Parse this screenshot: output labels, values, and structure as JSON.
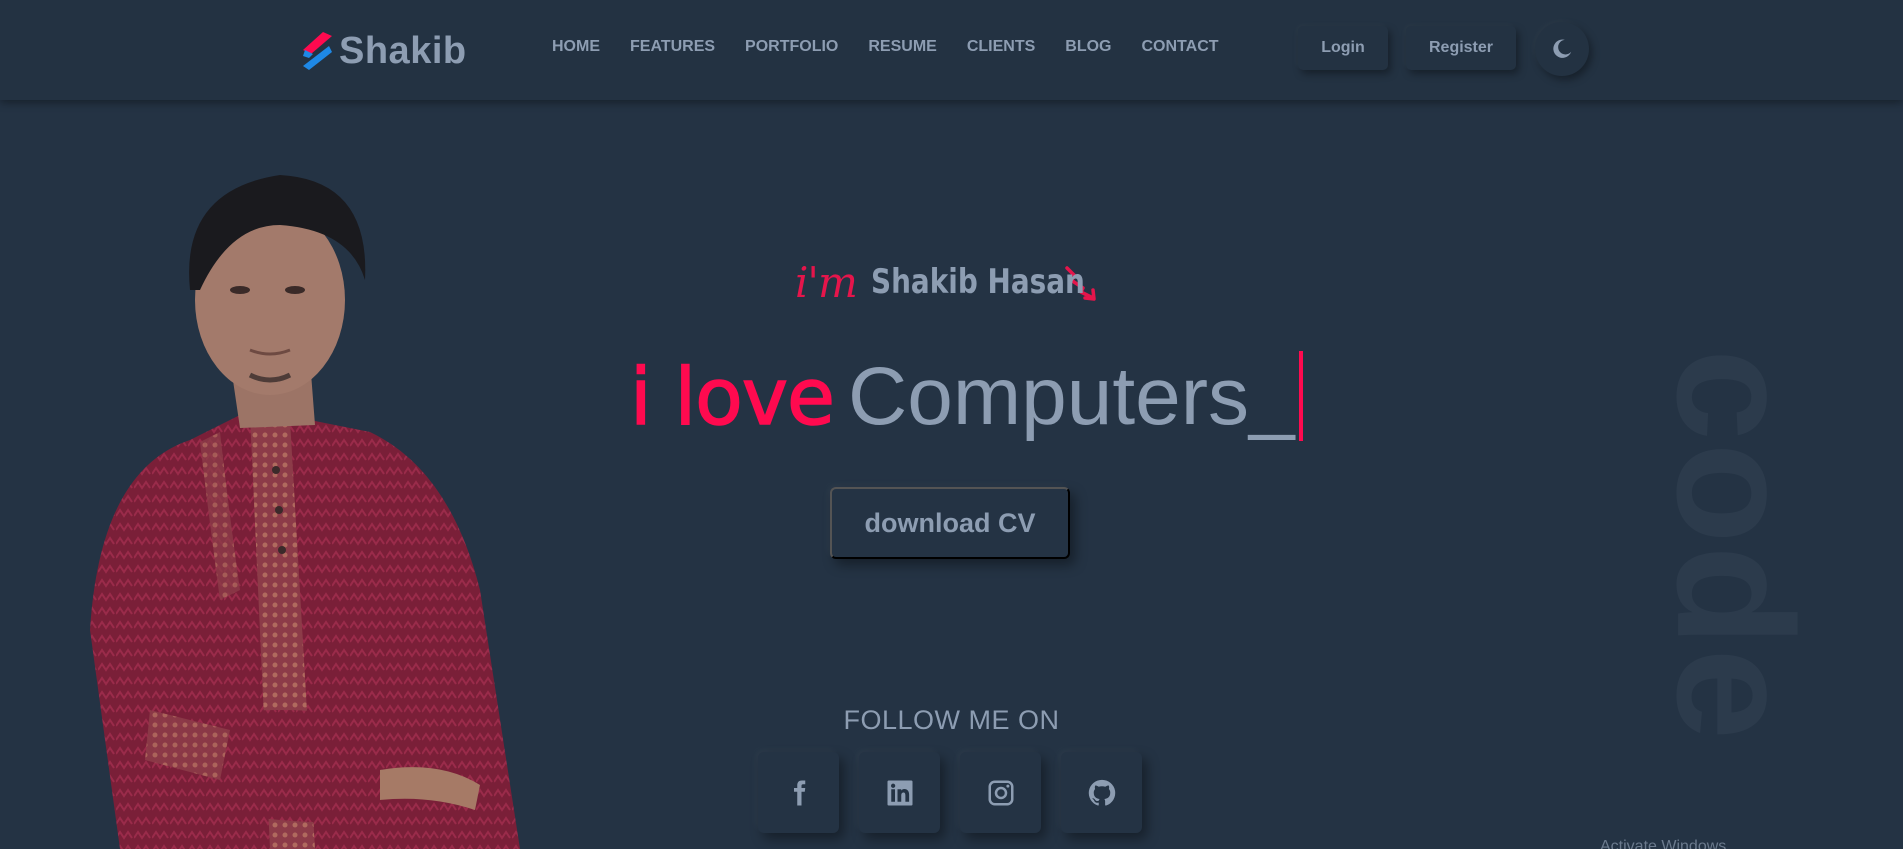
{
  "brand": {
    "name": "Shakib",
    "accent_colors": [
      "#ff0a4f",
      "#1e88e5"
    ]
  },
  "nav": {
    "items": [
      {
        "label": "HOME"
      },
      {
        "label": "FEATURES"
      },
      {
        "label": "PORTFOLIO"
      },
      {
        "label": "RESUME"
      },
      {
        "label": "CLIENTS"
      },
      {
        "label": "BLOG"
      },
      {
        "label": "CONTACT"
      }
    ],
    "login_label": "Login",
    "register_label": "Register",
    "theme_toggle_icon": "moon-icon"
  },
  "hero": {
    "greeting": "i'm",
    "name": "Shakib Hasan",
    "tagline_prefix": "i love",
    "tagline_word": "Computers_",
    "cv_button_label": "download CV",
    "vertical_word": "code",
    "accent_color": "#ff0a4f"
  },
  "follow": {
    "heading": "FOLLOW ME ON",
    "icons": [
      "facebook-icon",
      "linkedin-icon",
      "instagram-icon",
      "github-icon"
    ]
  },
  "watermark": "Activate Windows"
}
